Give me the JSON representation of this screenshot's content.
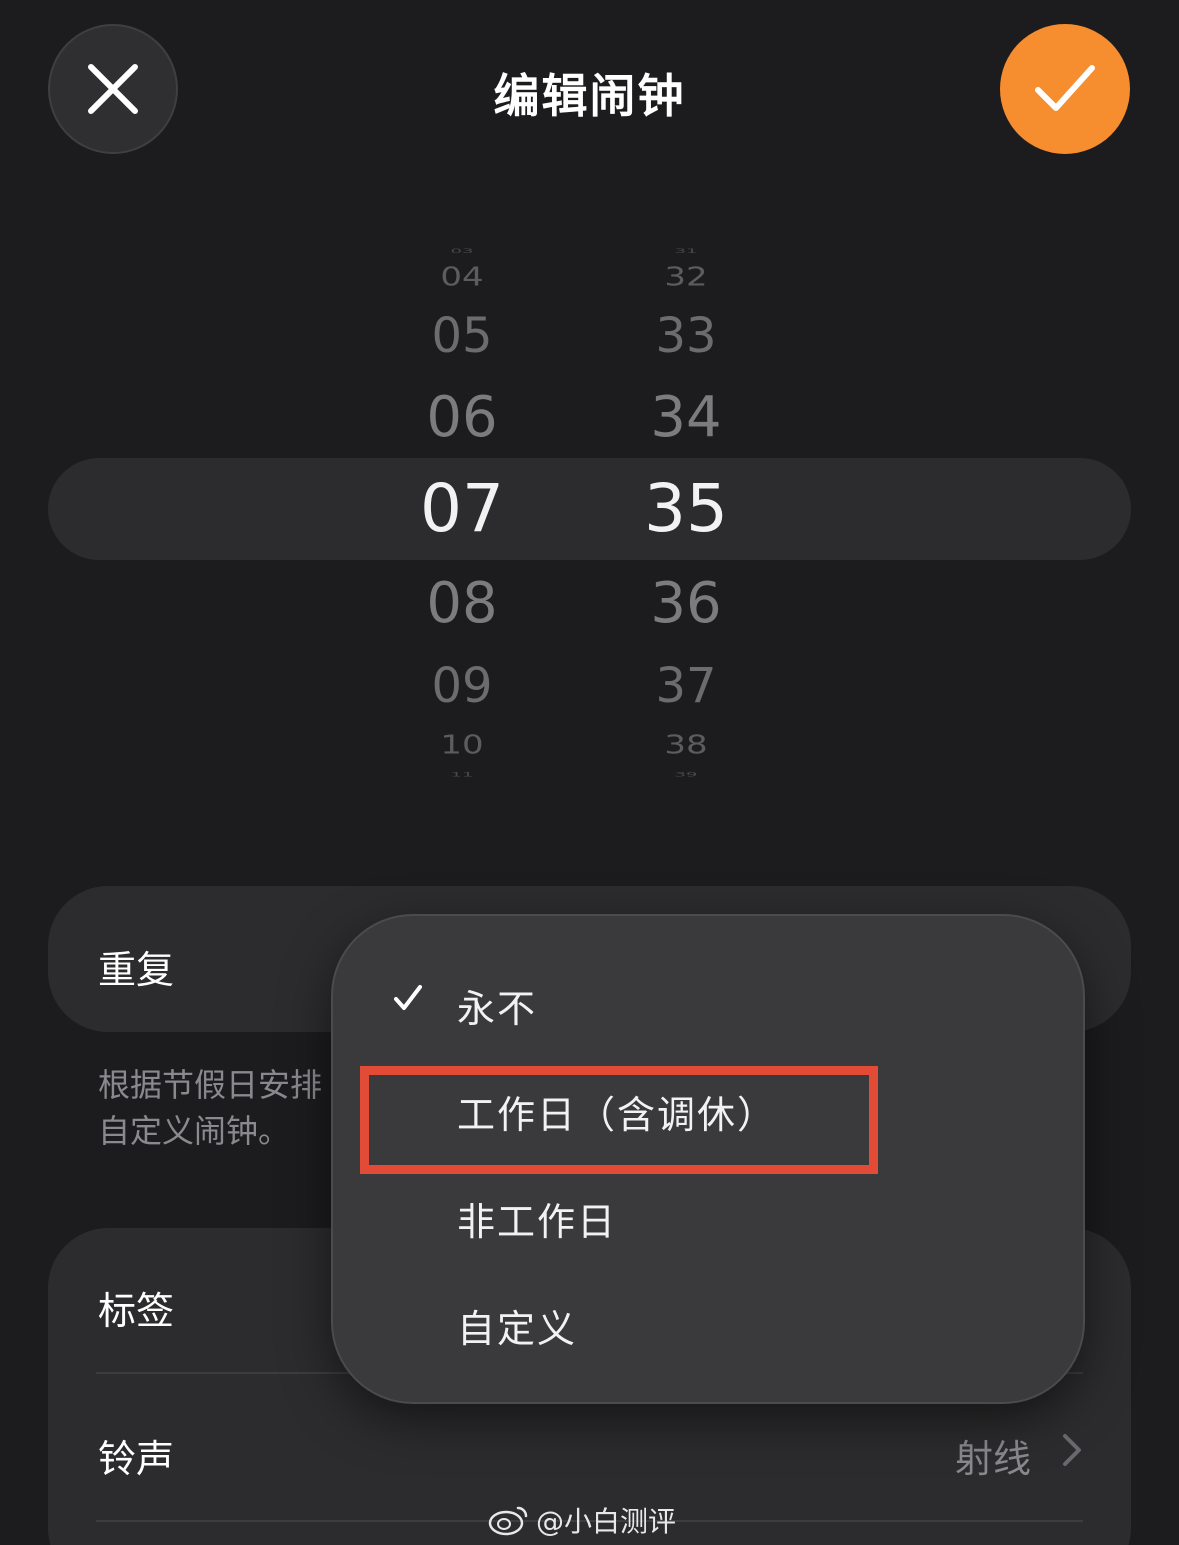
{
  "header": {
    "title": "编辑闹钟",
    "close_icon": "close-icon",
    "confirm_icon": "checkmark-icon",
    "accent_color": "#f68d2e"
  },
  "picker": {
    "hours": [
      "03",
      "04",
      "05",
      "06",
      "07",
      "08",
      "09",
      "10",
      "11"
    ],
    "minutes": [
      "31",
      "32",
      "33",
      "34",
      "35",
      "36",
      "37",
      "38",
      "39"
    ],
    "selected_hour": "07",
    "selected_minute": "35"
  },
  "repeat": {
    "label": "重复",
    "hint_line1": "根据节假日安排",
    "hint_line2": "自定义闹钟。"
  },
  "settings": {
    "label_row": "标签",
    "ringtone_row": "铃声",
    "ringtone_value": "射线"
  },
  "menu": {
    "items": [
      "永不",
      "工作日（含调休）",
      "非工作日",
      "自定义"
    ],
    "checked": "永不"
  },
  "highlight_color": "#e24c36",
  "watermark": "@小白测评"
}
